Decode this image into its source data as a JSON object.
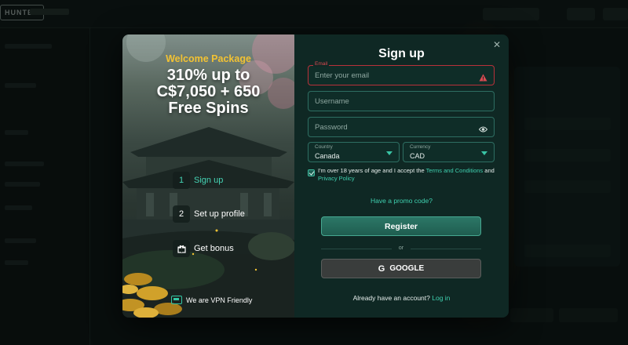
{
  "background": {
    "logo_text": "HUNTER"
  },
  "promo": {
    "kicker": "Welcome Package",
    "headline_lines": [
      "310% up to",
      "C$7,050 + 650",
      "Free Spins"
    ],
    "steps": [
      {
        "number": "1",
        "label": "Sign up",
        "active": true
      },
      {
        "number": "2",
        "label": "Set up profile",
        "active": false
      },
      {
        "number": "gift-icon",
        "label": "Get bonus",
        "active": false
      }
    ],
    "vpn_label": "We are VPN Friendly"
  },
  "form": {
    "title": "Sign up",
    "close_icon": "close-icon",
    "email": {
      "label": "Email",
      "placeholder": "Enter your email",
      "value": "",
      "state": "error",
      "icon": "warning-icon"
    },
    "username": {
      "placeholder": "Username",
      "value": ""
    },
    "password": {
      "placeholder": "Password",
      "value": "",
      "icon": "eye-icon"
    },
    "country": {
      "caption": "Country",
      "value": "Canada"
    },
    "currency": {
      "caption": "Currency",
      "value": "CAD"
    },
    "terms": {
      "checked": true,
      "text_before": "I'm over 18 years of age and I accept the ",
      "terms_link": "Terms and Conditions",
      "text_middle": " and ",
      "privacy_link": "Privacy Policy"
    },
    "promo_code_link": "Have a promo code?",
    "register_label": "Register",
    "or_label": "or",
    "google_icon": "G",
    "google_label": "GOOGLE",
    "account_text": "Already have an account?",
    "login_link": "Log in"
  },
  "colors": {
    "accent": "#3fd0af",
    "gold": "#f2c233",
    "error": "#d94b52",
    "form_bg": "#0f2824"
  }
}
